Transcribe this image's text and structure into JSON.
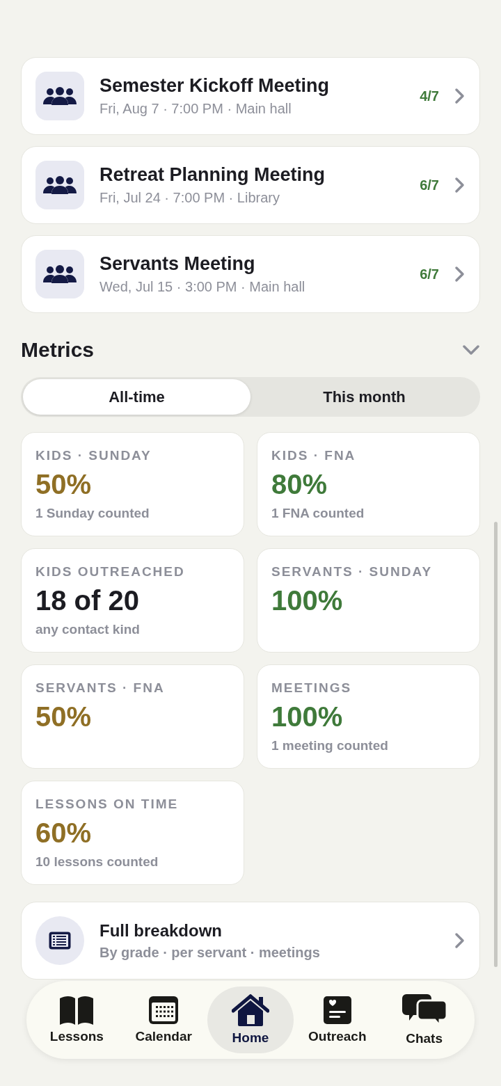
{
  "meetings": [
    {
      "title": "Semester Kickoff Meeting",
      "subtitle": "Fri, Aug 7 · 7:00 PM · Main hall",
      "count": "4/7"
    },
    {
      "title": "Retreat Planning Meeting",
      "subtitle": "Fri, Jul 24 · 7:00 PM · Library",
      "count": "6/7"
    },
    {
      "title": "Servants Meeting",
      "subtitle": "Wed, Jul 15 · 3:00 PM · Main hall",
      "count": "6/7"
    }
  ],
  "metrics": {
    "title": "Metrics",
    "segments": [
      {
        "label": "All-time",
        "selected": true
      },
      {
        "label": "This month",
        "selected": false
      }
    ],
    "cards": [
      {
        "label": "KIDS · SUNDAY",
        "value": "50%",
        "note": "1 Sunday counted",
        "color": "#8f6f25"
      },
      {
        "label": "KIDS · FNA",
        "value": "80%",
        "note": "1 FNA counted",
        "color": "#3f7a3a"
      },
      {
        "label": "KIDS OUTREACHED",
        "value": "18 of 20",
        "note": "any contact kind",
        "color": "#1c1c22"
      },
      {
        "label": "SERVANTS · SUNDAY",
        "value": "100%",
        "color": "#3f7a3a"
      },
      {
        "label": "SERVANTS · FNA",
        "value": "50%",
        "color": "#8f6f25"
      },
      {
        "label": "MEETINGS",
        "value": "100%",
        "note": "1 meeting counted",
        "color": "#3f7a3a"
      },
      {
        "label": "LESSONS ON TIME",
        "value": "60%",
        "note": "10 lessons counted",
        "color": "#8f6f25"
      }
    ]
  },
  "breakdown": {
    "title": "Full breakdown",
    "subtitle": "By grade · per servant · meetings"
  },
  "tab_bar": [
    {
      "label": "Lessons",
      "kind": "book",
      "selected": false
    },
    {
      "label": "Calendar",
      "kind": "calendar",
      "selected": false
    },
    {
      "label": "Home",
      "kind": "home",
      "selected": true
    },
    {
      "label": "Outreach",
      "kind": "card",
      "selected": false
    },
    {
      "label": "Chats",
      "kind": "chats",
      "selected": false
    }
  ]
}
